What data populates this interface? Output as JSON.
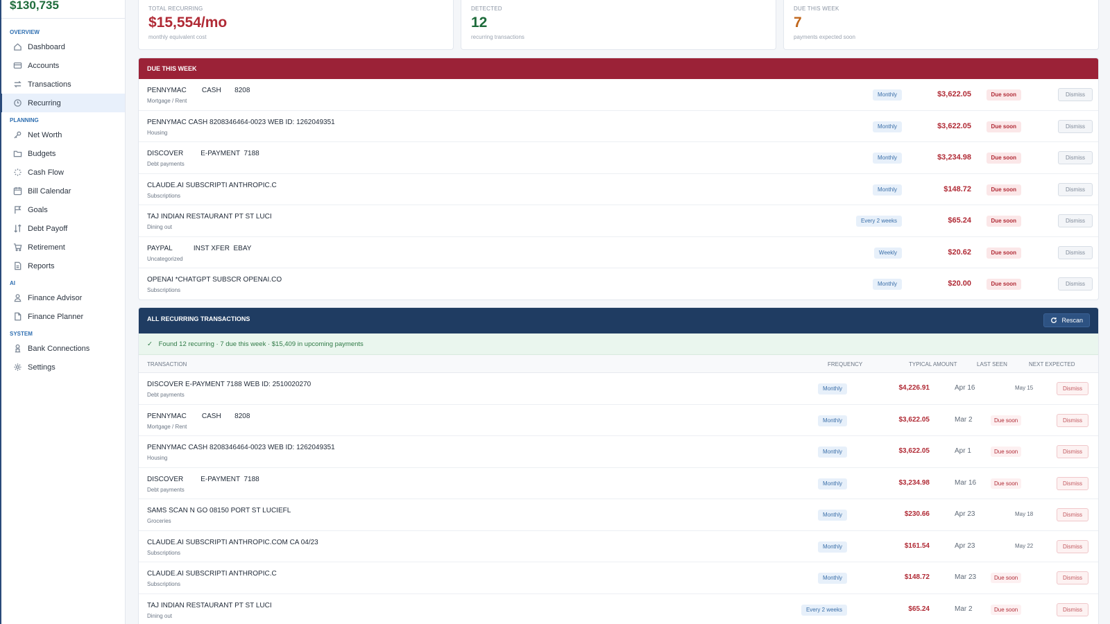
{
  "sidebar": {
    "net_worth": "$130,735",
    "sections": [
      {
        "label": "OVERVIEW",
        "items": [
          {
            "label": "Dashboard",
            "icon": "home-icon",
            "active": false
          },
          {
            "label": "Accounts",
            "icon": "card-icon",
            "active": false
          },
          {
            "label": "Transactions",
            "icon": "arrows-icon",
            "active": false
          },
          {
            "label": "Recurring",
            "icon": "recurring-icon",
            "active": true
          }
        ]
      },
      {
        "label": "PLANNING",
        "items": [
          {
            "label": "Net Worth",
            "icon": "key-icon"
          },
          {
            "label": "Budgets",
            "icon": "folder-icon"
          },
          {
            "label": "Cash Flow",
            "icon": "spinner-icon"
          },
          {
            "label": "Bill Calendar",
            "icon": "calendar-icon"
          },
          {
            "label": "Goals",
            "icon": "flag-icon"
          },
          {
            "label": "Debt Payoff",
            "icon": "sort-icon"
          },
          {
            "label": "Retirement",
            "icon": "cart-icon"
          },
          {
            "label": "Reports",
            "icon": "report-icon"
          }
        ]
      },
      {
        "label": "AI",
        "items": [
          {
            "label": "Finance Advisor",
            "icon": "advisor-icon"
          },
          {
            "label": "Finance Planner",
            "icon": "document-icon"
          }
        ]
      },
      {
        "label": "SYSTEM",
        "items": [
          {
            "label": "Bank Connections",
            "icon": "bank-icon"
          },
          {
            "label": "Settings",
            "icon": "gear-icon"
          }
        ]
      }
    ]
  },
  "summary": [
    {
      "label": "TOTAL RECURRING",
      "value": "$15,554/mo",
      "sub": "monthly equivalent cost",
      "color": "#b02a35"
    },
    {
      "label": "DETECTED",
      "value": "12",
      "sub": "recurring transactions",
      "color": "#1d6b3a"
    },
    {
      "label": "DUE THIS WEEK",
      "value": "7",
      "sub": "payments expected soon",
      "color": "#c0651a"
    }
  ],
  "due_week": {
    "title": "DUE THIS WEEK",
    "due_label": "Due soon",
    "dismiss_label": "Dismiss",
    "rows": [
      {
        "name": "PENNYMAC        CASH       8208",
        "category": "Mortgage / Rent",
        "frequency": "Monthly",
        "amount": "$3,622.05"
      },
      {
        "name": "PENNYMAC CASH 8208346464-0023 WEB ID: 1262049351",
        "category": "Housing",
        "frequency": "Monthly",
        "amount": "$3,622.05"
      },
      {
        "name": "DISCOVER         E-PAYMENT  7188",
        "category": "Debt payments",
        "frequency": "Monthly",
        "amount": "$3,234.98"
      },
      {
        "name": "CLAUDE.AI SUBSCRIPTI ANTHROPIC.C",
        "category": "Subscriptions",
        "frequency": "Monthly",
        "amount": "$148.72"
      },
      {
        "name": "TAJ INDIAN RESTAURANT PT ST LUCI",
        "category": "Dining out",
        "frequency": "Every 2 weeks",
        "amount": "$65.24"
      },
      {
        "name": "PAYPAL           INST XFER  EBAY",
        "category": "Uncategorized",
        "frequency": "Weekly",
        "amount": "$20.62"
      },
      {
        "name": "OPENAI *CHATGPT SUBSCR OPENAI.CO",
        "category": "Subscriptions",
        "frequency": "Monthly",
        "amount": "$20.00"
      }
    ]
  },
  "all_recurring": {
    "title": "ALL RECURRING TRANSACTIONS",
    "rescan_label": "Rescan",
    "found_text": "Found 12 recurring · 7 due this week · $15,409 in upcoming payments",
    "columns": {
      "transaction": "TRANSACTION",
      "frequency": "FREQUENCY",
      "amount": "TYPICAL AMOUNT",
      "last_seen": "LAST SEEN",
      "next": "NEXT EXPECTED"
    },
    "dismiss_label": "Dismiss",
    "rows": [
      {
        "name": "DISCOVER E-PAYMENT 7188 WEB ID: 2510020270",
        "category": "Debt payments",
        "frequency": "Monthly",
        "amount": "$4,226.91",
        "last_seen": "Apr 16",
        "next": "May 15",
        "due": false
      },
      {
        "name": "PENNYMAC        CASH       8208",
        "category": "Mortgage / Rent",
        "frequency": "Monthly",
        "amount": "$3,622.05",
        "last_seen": "Mar 2",
        "next": "Due soon",
        "due": true
      },
      {
        "name": "PENNYMAC CASH 8208346464-0023 WEB ID: 1262049351",
        "category": "Housing",
        "frequency": "Monthly",
        "amount": "$3,622.05",
        "last_seen": "Apr 1",
        "next": "Due soon",
        "due": true
      },
      {
        "name": "DISCOVER         E-PAYMENT  7188",
        "category": "Debt payments",
        "frequency": "Monthly",
        "amount": "$3,234.98",
        "last_seen": "Mar 16",
        "next": "Due soon",
        "due": true
      },
      {
        "name": "SAMS SCAN N GO 08150 PORT ST LUCIEFL",
        "category": "Groceries",
        "frequency": "Monthly",
        "amount": "$230.66",
        "last_seen": "Apr 23",
        "next": "May 18",
        "due": false
      },
      {
        "name": "CLAUDE.AI SUBSCRIPTI ANTHROPIC.COM CA 04/23",
        "category": "Subscriptions",
        "frequency": "Monthly",
        "amount": "$161.54",
        "last_seen": "Apr 23",
        "next": "May 22",
        "due": false
      },
      {
        "name": "CLAUDE.AI SUBSCRIPTI ANTHROPIC.C",
        "category": "Subscriptions",
        "frequency": "Monthly",
        "amount": "$148.72",
        "last_seen": "Mar 23",
        "next": "Due soon",
        "due": true
      },
      {
        "name": "TAJ INDIAN RESTAURANT PT ST LUCI",
        "category": "Dining out",
        "frequency": "Every 2 weeks",
        "amount": "$65.24",
        "last_seen": "Mar 2",
        "next": "Due soon",
        "due": true
      }
    ]
  }
}
